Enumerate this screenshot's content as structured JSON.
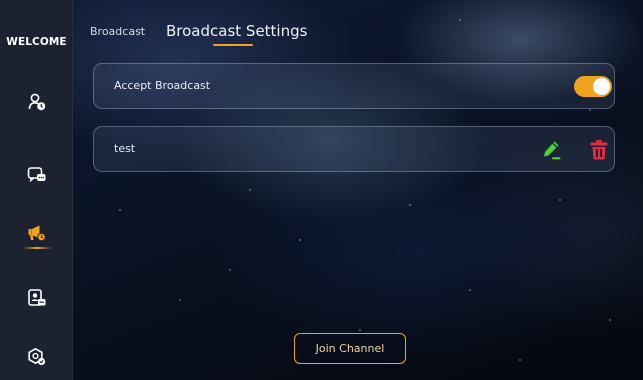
{
  "sidebar": {
    "brand": "WELCOME",
    "items": [
      {
        "icon": "user-clock-icon",
        "active": false
      },
      {
        "icon": "chat-bubbles-icon",
        "active": false
      },
      {
        "icon": "broadcast-megaphone-icon",
        "active": true
      },
      {
        "icon": "contact-card-icon",
        "active": false
      },
      {
        "icon": "settings-hex-icon",
        "active": false
      }
    ]
  },
  "header": {
    "tabs": [
      {
        "label": "Broadcast",
        "active": false
      },
      {
        "label": "Broadcast Settings",
        "active": true
      }
    ]
  },
  "settings": {
    "accept_broadcast_label": "Accept Broadcast",
    "accept_broadcast_enabled": true
  },
  "channels": [
    {
      "name": "test"
    }
  ],
  "actions": {
    "join_label": "Join Channel"
  },
  "colors": {
    "accent": "#f0a31c",
    "edit": "#4cd137",
    "delete": "#e8283c",
    "sidebar_bg": "#1c2230"
  }
}
